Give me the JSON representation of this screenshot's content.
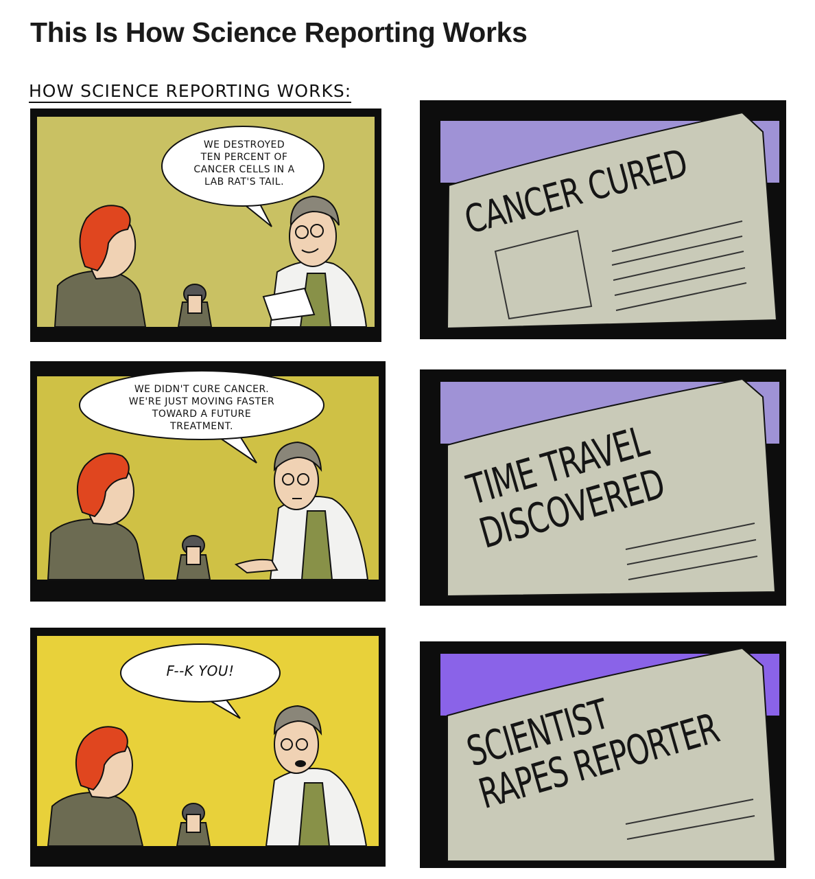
{
  "title": "This Is How Science Reporting Works",
  "caption": "HOW SCIENCE REPORTING WORKS:",
  "panels": [
    {
      "speech_lines": [
        "WE DESTROYED",
        "TEN PERCENT OF",
        "CANCER CELLS IN A",
        "LAB RAT'S TAIL."
      ]
    },
    {
      "headline_lines": [
        "CANCER CURED"
      ]
    },
    {
      "speech_lines": [
        "WE DIDN'T CURE CANCER.",
        "WE'RE JUST MOVING FASTER",
        "TOWARD A FUTURE",
        "TREATMENT."
      ]
    },
    {
      "headline_lines": [
        "TIME TRAVEL",
        "DISCOVERED"
      ]
    },
    {
      "speech_lines": [
        "F--K YOU!"
      ]
    },
    {
      "headline_lines": [
        "SCIENTIST",
        "RAPES REPORTER"
      ]
    }
  ],
  "colors": {
    "bg_panel1": "#c9c163",
    "bg_panel3": "#cfc145",
    "bg_panel5": "#e8d13a",
    "sky": "#9f92d6",
    "sky_dark": "#8a63e8",
    "newspaper": "#c9cab8",
    "hair": "#e0461f",
    "coat": "#6c6b52",
    "shirt": "#889148"
  }
}
